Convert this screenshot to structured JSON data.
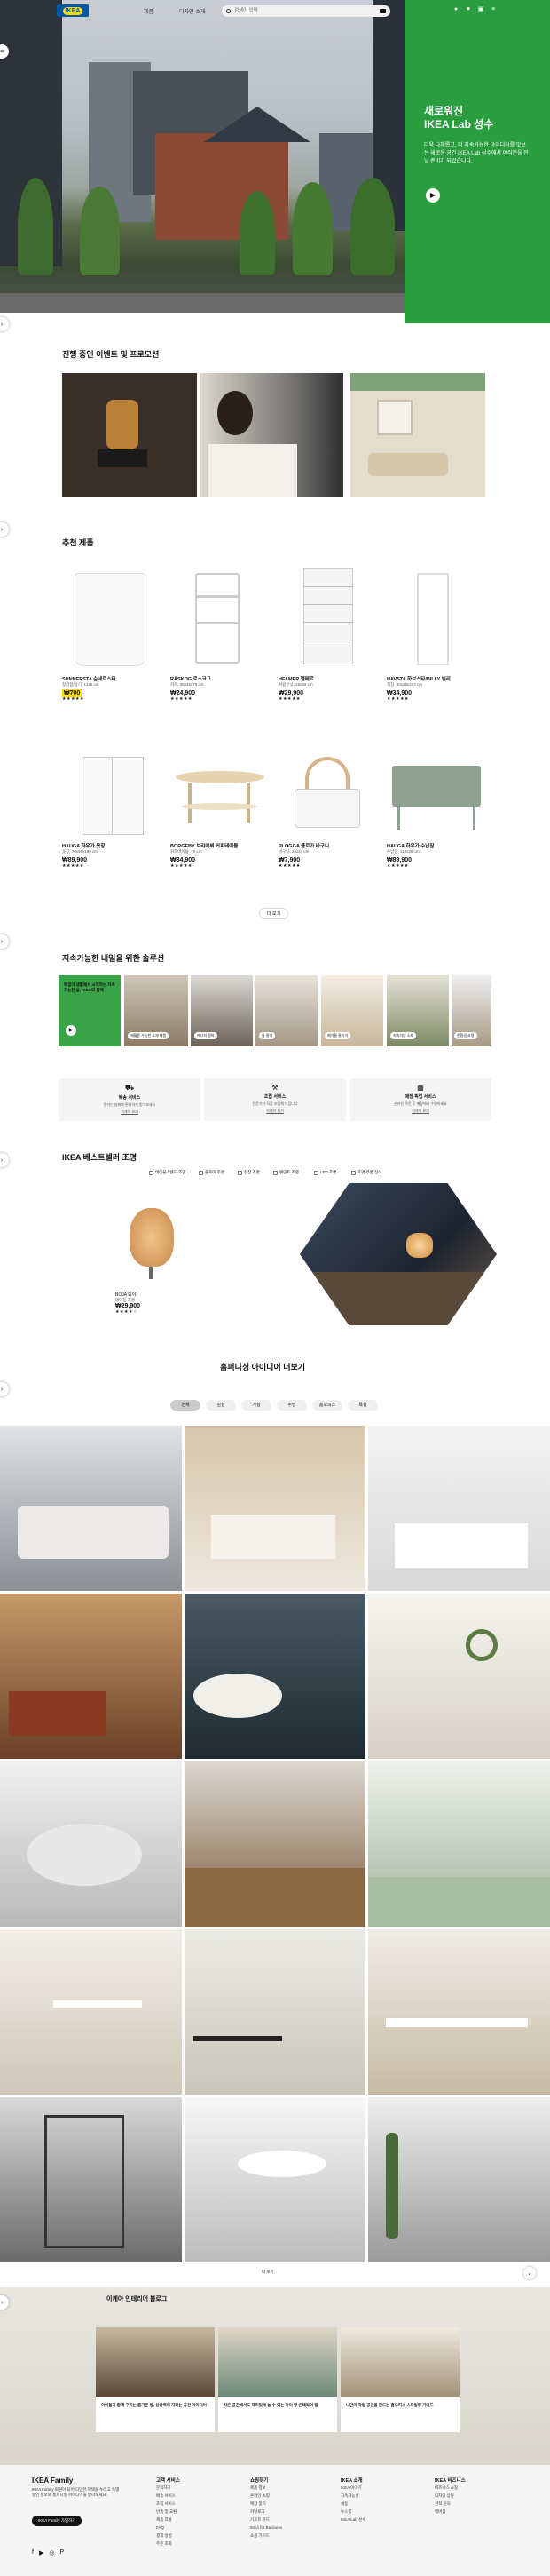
{
  "header": {
    "logo": "IKEA",
    "nav": [
      "제품",
      "디자인 소개"
    ],
    "search_placeholder": "검색어 입력",
    "icons": [
      "user-icon",
      "heart-icon",
      "cart-icon",
      "menu-icon"
    ]
  },
  "hero": {
    "title_line1": "새로워진",
    "title_line2": "IKEA Lab 성수",
    "description": "더욱 다채롭고, 더 지속가능한 아이디어를 맛보는 새로운 공간 IKEA Lab 성수에서 여러분을 만날 준비가 되었습니다.",
    "button_icon": "play-icon"
  },
  "promotions": {
    "title": "진행 중인 이벤트 및 프로모션"
  },
  "products": {
    "title": "추천 제품",
    "items": [
      {
        "name": "SUNNERSTA 순네르스타",
        "desc": "정리함/용기, 12x8 cm",
        "price": "₩700",
        "badge": true,
        "stars": "★★★★★"
      },
      {
        "name": "RÅSKOG 로스코그",
        "desc": "카트, 35x45x78 cm",
        "price": "₩24,900",
        "badge": false,
        "stars": "★★★★★"
      },
      {
        "name": "HELMER 헬메르",
        "desc": "서랍유닛, 28x69 cm",
        "price": "₩29,900",
        "badge": false,
        "stars": "★★★★★"
      },
      {
        "name": "HAVSTA 하브스타/BILLY 빌리",
        "desc": "책장, 40x28x202 cm",
        "price": "₩34,900",
        "badge": false,
        "stars": "★★★★★"
      },
      {
        "name": "HAUGA 하우가 옷장",
        "desc": "옷장, 70x55x199 cm",
        "price": "₩89,900",
        "badge": false,
        "stars": "★★★★★"
      },
      {
        "name": "BORGEBY 보리에뷔 커피테이블",
        "desc": "커피테이블, 70 cm",
        "price": "₩34,900",
        "badge": false,
        "stars": "★★★★★"
      },
      {
        "name": "PLOGGA 플로가 바구니",
        "desc": "바구니, 24x24 cm",
        "price": "₩7,900",
        "badge": false,
        "stars": "★★★★★"
      },
      {
        "name": "HAUGA 하우가 수납장",
        "desc": "수납장, 118x39 cm",
        "price": "₩89,900",
        "badge": false,
        "stars": "★★★★★"
      }
    ],
    "more_label": "더 보기"
  },
  "sustain": {
    "title": "지속가능한 내일을 위한 솔루션",
    "green_text": "매일의 생활에서 시작하는 지속가능한 삶, IKEA와 함께",
    "tags": [
      "재활용 가능한 소재 제품",
      "에너지 절약",
      "물 절약",
      "폐기물 줄이기",
      "지속가능 소재",
      "친환경 조명",
      "업사이클링"
    ],
    "services": [
      {
        "icon": "truck-icon",
        "title": "배송 서비스",
        "desc": "원하는 날짜에 편리하게 받아보세요",
        "link": "자세히 보기"
      },
      {
        "icon": "tool-icon",
        "title": "조립 서비스",
        "desc": "전문가가 직접 조립해 드립니다",
        "link": "자세히 보기"
      },
      {
        "icon": "calendar-icon",
        "title": "매장 픽업 서비스",
        "desc": "온라인 주문 후 매장에서 수령하세요",
        "link": "자세히 보기"
      }
    ]
  },
  "bestseller": {
    "title": "IKEA 베스트셀러 조명",
    "filters": [
      "테이블스탠드 조명",
      "플로어 조명",
      "천장 조명",
      "펜던트 조명",
      "LED 조명",
      "조명 부품 장식"
    ],
    "product": {
      "name": "BÖJA 뵈야",
      "desc": "테이블 조명",
      "price": "₩29,900",
      "stars": "★★★★☆"
    }
  },
  "ideas": {
    "title": "홈퍼니싱 아이디어 더보기",
    "chips": [
      "전체",
      "침실",
      "거실",
      "주방",
      "홈오피스",
      "욕실"
    ],
    "more_label": "더 보기"
  },
  "blog": {
    "title": "이케아 인테리어 블로그",
    "cards": [
      {
        "text": "아이들과 함께 꾸미는 즐거운 방, 상상력이 자라는 공간 아이디어"
      },
      {
        "text": "작은 공간에서도 재미있게 놀 수 있는 아이 방 인테리어 팁"
      },
      {
        "text": "나만의 작업 공간을 만드는 홈오피스 스타일링 가이드"
      }
    ]
  },
  "footer": {
    "family_title": "IKEA Family",
    "family_desc": "IKEA Family 회원이 되어 다양한 혜택을 누리고 특별 할인 정보와 홈퍼니싱 아이디어를 받아보세요.",
    "family_button": "IKEA Family 가입하기",
    "columns": [
      {
        "title": "고객 서비스",
        "items": [
          "문의하기",
          "배송 서비스",
          "조립 서비스",
          "반품 및 교환",
          "제품 리콜",
          "FAQ",
          "결제 방법",
          "주문 조회"
        ]
      },
      {
        "title": "쇼핑하기",
        "items": [
          "제품 정보",
          "온라인 쇼핑",
          "매장 찾기",
          "카탈로그",
          "기프트 카드",
          "IKEA for Business",
          "쇼핑 가이드"
        ]
      },
      {
        "title": "IKEA 소개",
        "items": [
          "IKEA 이야기",
          "지속가능성",
          "채용",
          "뉴스룸",
          "IKEA Lab 성수"
        ]
      },
      {
        "title": "IKEA 비즈니스",
        "items": [
          "비즈니스 쇼핑",
          "디자인 상담",
          "견적 문의",
          "멤버십"
        ]
      }
    ],
    "social": [
      "facebook-icon",
      "youtube-icon",
      "instagram-icon",
      "pinterest-icon"
    ]
  }
}
